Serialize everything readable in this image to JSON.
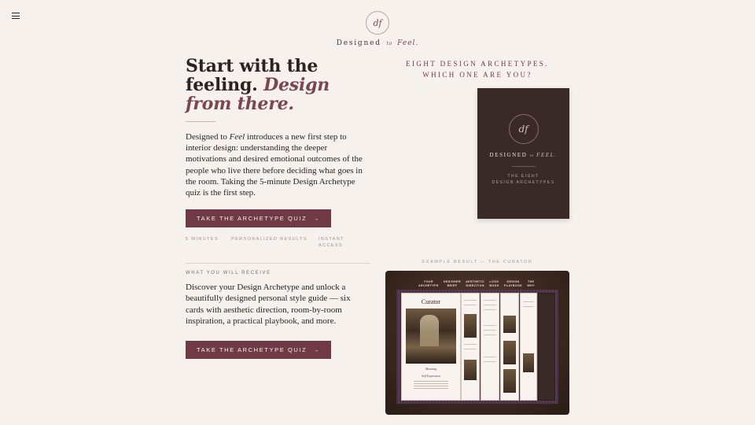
{
  "brand": {
    "monogram": "df",
    "wordmark_pre": "Designed",
    "wordmark_small": "to",
    "wordmark_post": "Feel."
  },
  "hero": {
    "headline_line1": "Start with the",
    "headline_line2a": "feeling.",
    "headline_line2b": "Design",
    "headline_line3": "from there.",
    "intro_pre": "Designed to ",
    "intro_em": "Feel",
    "intro_post": " introduces a new first step to interior design: understanding the deeper motivations and desired emotional outcomes of the people who live there before deciding what goes in the room. Taking the 5-minute Design Archetype quiz is the first step.",
    "cta_label": "TAKE THE ARCHETYPE QUIZ",
    "cta_arrow": "→",
    "stats": [
      "5 MINUTES",
      "PERSONALIZED RESULTS",
      "INSTANT ACCESS"
    ]
  },
  "receive": {
    "label": "WHAT YOU WILL RECEIVE",
    "text": "Discover your Design Archetype and unlock a beautifully designed personal style guide — six cards with aesthetic direction, room-by-room inspiration, a practical playbook, and more.",
    "cta_label": "TAKE THE ARCHETYPE QUIZ",
    "cta_arrow": "→"
  },
  "archetypes": {
    "heading_line1": "EIGHT DESIGN ARCHETYPES.",
    "heading_line2": "WHICH ONE ARE YOU?",
    "book": {
      "monogram": "df",
      "title_pre": "DESIGNED",
      "title_small": "to",
      "title_post": "FEEL.",
      "sub_line1": "THE EIGHT",
      "sub_line2": "DESIGN ARCHETYPES"
    }
  },
  "example": {
    "caption": "EXAMPLE RESULT — THE CURATOR",
    "tabs": [
      [
        "YOUR",
        "ARCHETYPE"
      ],
      [
        "DESIGNER",
        "BRIEF"
      ],
      [
        "AESTHETIC",
        "DIRECTION"
      ],
      [
        "LOOK",
        "BOOK"
      ],
      [
        "DESIGN",
        "PLAYBOOK"
      ],
      [
        "THE",
        "WHY"
      ]
    ],
    "card_title": "Curator",
    "card_label1": "Meaning",
    "card_label2": "Self Expression"
  }
}
